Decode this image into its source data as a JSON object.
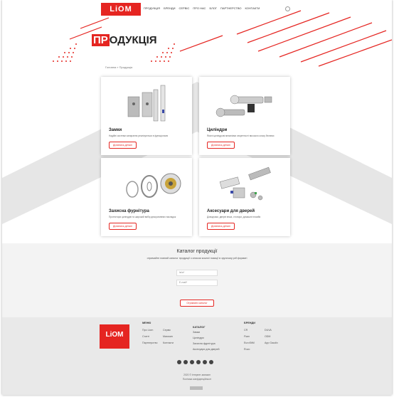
{
  "colors": {
    "accent": "#e52521",
    "grey_shape": "#e6e6e6"
  },
  "header": {
    "logo": "LiOM",
    "nav": [
      "ПРОДУКЦІЯ",
      "БРЕНДИ",
      "СЕРВІС",
      "ПРО НАС",
      "БЛОГ",
      "ПАРТНЕРСТВО",
      "КОНТАКТИ"
    ],
    "search_icon": "search-icon"
  },
  "hero": {
    "title_highlight": "ПР",
    "title_rest": "ОДУКЦІЯ",
    "breadcrumb": "Головна » Продукція"
  },
  "cards": [
    {
      "title": "Замки",
      "desc": "Надійні системи запирання реалізуються в функціонали",
      "button": "Дізнатись деталі"
    },
    {
      "title": "Циліндри",
      "desc": "Якісні циліндрові механізми секретності високого класу безпеки",
      "button": "Дізнатись деталі"
    },
    {
      "title": "Захисна фурнітура",
      "desc": "Протектори циліндрів та широкий вибір декоративних накладок",
      "button": "Дізнатись деталі"
    },
    {
      "title": "Аксесуари для дверей",
      "desc": "Доводчики, дверні вічка, стопори, домашні пломби",
      "button": "Дізнатись деталі"
    }
  ],
  "catalog": {
    "title": "Каталог продукції",
    "subtitle": "отримайте повний каталог продукції з описом кожної позиції в зручному pdf форматі",
    "name_placeholder": "Ім'я*",
    "email_placeholder": "E-mail*",
    "button": "Отримати каталог"
  },
  "footer": {
    "logo": "LiOM",
    "menu_title": "МЕНЮ",
    "menu_links": [
      "Про Liom",
      "Сервіс",
      "Статті",
      "Магазин",
      "Партнерство",
      "Контакти"
    ],
    "catalog_title": "КАТАЛОГ",
    "catalog_links": [
      "Замки",
      "Циліндри",
      "Захисна фурнітура",
      "Аксесуари для дверей"
    ],
    "brands_title": "БРЕНДИ",
    "brands_links": [
      "CR",
      "DUVA",
      "Fiam",
      "ODM",
      "EuroStiM",
      "App Gaudix",
      "Ruvo"
    ],
    "copyright": "2020 © Інтернет-магазин",
    "copyright2": "Політика конфіденційності"
  }
}
